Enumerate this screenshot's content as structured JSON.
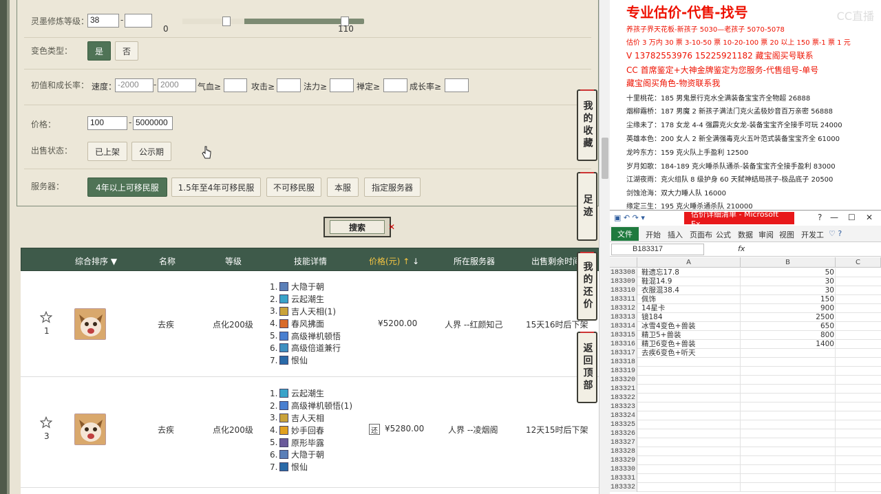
{
  "filter": {
    "level_label": "灵墨修炼等级：",
    "level_min": "38",
    "level_max": "",
    "slider_min": "0",
    "slider_max": "110",
    "color_label": "变色类型：",
    "color_yes": "是",
    "color_no": "否",
    "growth_label": "初值和成长率：",
    "speed_label": "速度：",
    "speed_min": "-2000",
    "speed_max": "2000",
    "hp_label": "气血≥",
    "atk_label": "攻击≥",
    "mag_label": "法力≥",
    "focus_label": "禅定≥",
    "growth_rate_label": "成长率≥",
    "price_label": "价格：",
    "price_min": "100",
    "price_max": "5000000",
    "status_label": "出售状态：",
    "status_listed": "已上架",
    "status_public": "公示期",
    "server_label": "服务器：",
    "servers": [
      "4年以上可移民服",
      "1.5年至4年可移民服",
      "不可移民服",
      "本服",
      "指定服务器"
    ],
    "search": "搜索"
  },
  "table": {
    "headers": {
      "sort": "综合排序",
      "name": "名称",
      "level": "等级",
      "skills": "技能详情",
      "price": "价格(元)",
      "server": "所在服务器",
      "time": "出售剩余时间"
    },
    "rows": [
      {
        "index": "1",
        "name": "去疾",
        "level": "点化200级",
        "skills": [
          "大隐于朝",
          "云起潮生",
          "吉人天相(1)",
          "春风拂面",
          "高级禅机顿悟",
          "高级倍道兼行",
          "恨仙"
        ],
        "price": "¥5200.00",
        "server": "人界 --红颜知己",
        "time": "15天16时后下架",
        "haggle": ""
      },
      {
        "index": "3",
        "name": "去疾",
        "level": "点化200级",
        "skills": [
          "云起潮生",
          "高级禅机顿悟(1)",
          "吉人天相",
          "妙手回春",
          "原形毕露",
          "大隐于朝",
          "恨仙"
        ],
        "price": "¥5280.00",
        "server": "人界 --凌烟阁",
        "time": "12天15时后下架",
        "haggle": "还"
      }
    ]
  },
  "side_tabs": [
    "我的收藏",
    "足迹",
    "我的还价",
    "返回顶部"
  ],
  "ad": {
    "title": "专业估价-代售-找号",
    "line1": "养孩子界天花板-新孩子 5030—老孩子 5070-5078",
    "line2": "估价 3 万内 30 票  3-10-50 票  10-20-100 票  20 以上 150 票-1 票 1 元",
    "line3": "V 13782553976    15225921182  藏宝阁买号联系",
    "line4": "CC 首席鉴定+大神金牌鉴定为您服务-代售组号-单号",
    "line5": "藏宝阁买角色-物资联系我",
    "items": [
      "十里桃花：185 男鬼景行克水全满装备宝宝齐全物超 26888",
      "烟柳霜桥：187 男魔 2 新孩子满法门克火孟极妙音百万亲密 56888",
      "尘缘未了：178 女龙 4-4 强霹克火女龙-装备宝宝齐全接手可玩 24000",
      "英雄本色：200 女人 2 新全满强毒克火五叶范式装备宝宝齐全 61000",
      "龙吟东方：159 克火队上手盈利 12500",
      "岁月如歌：184-189 克火睡杀队通杀-装备宝宝齐全接手盈利 83000",
      "江湖夜雨：克火组队 8 级护身 60 天弑神结局孩子-极品底子 20500",
      "剑蚀沧海：双大力睡人队 16000",
      "缘定三生：195 克火睡杀通杀队 210000"
    ],
    "watermark": "CC直播"
  },
  "excel": {
    "title": "估价详细清单 - Microsoft Ex...",
    "ribbon": [
      "开始",
      "插入",
      "页面布",
      "公式",
      "数据",
      "审阅",
      "视图",
      "开发工"
    ],
    "file": "文件",
    "namebox": "B183317",
    "fx": "fx",
    "cols": [
      "A",
      "B",
      "C"
    ],
    "rows": [
      {
        "n": "183308",
        "a": "鞋遗忘17.8",
        "b": "50"
      },
      {
        "n": "183309",
        "a": "鞋混14.9",
        "b": "30"
      },
      {
        "n": "183310",
        "a": "衣服混38.4",
        "b": "30"
      },
      {
        "n": "183311",
        "a": "佩饰",
        "b": "150"
      },
      {
        "n": "183312",
        "a": "14星卡",
        "b": "900"
      },
      {
        "n": "183313",
        "a": "镜184",
        "b": "2500"
      },
      {
        "n": "183314",
        "a": "冰雪4变色+兽装",
        "b": "650"
      },
      {
        "n": "183315",
        "a": "精卫5+兽装",
        "b": "800"
      },
      {
        "n": "183316",
        "a": "精卫6变色+兽装",
        "b": "1400"
      },
      {
        "n": "183317",
        "a": "去疾6变色+听天",
        "b": ""
      },
      {
        "n": "183318",
        "a": "",
        "b": ""
      },
      {
        "n": "183319",
        "a": "",
        "b": ""
      },
      {
        "n": "183320",
        "a": "",
        "b": ""
      },
      {
        "n": "183321",
        "a": "",
        "b": ""
      },
      {
        "n": "183322",
        "a": "",
        "b": ""
      },
      {
        "n": "183323",
        "a": "",
        "b": ""
      },
      {
        "n": "183324",
        "a": "",
        "b": ""
      },
      {
        "n": "183325",
        "a": "",
        "b": ""
      },
      {
        "n": "183326",
        "a": "",
        "b": ""
      },
      {
        "n": "183327",
        "a": "",
        "b": ""
      },
      {
        "n": "183328",
        "a": "",
        "b": ""
      },
      {
        "n": "183329",
        "a": "",
        "b": ""
      },
      {
        "n": "183330",
        "a": "",
        "b": ""
      },
      {
        "n": "183331",
        "a": "",
        "b": ""
      },
      {
        "n": "183332",
        "a": "",
        "b": ""
      }
    ]
  },
  "colors": {
    "accent_green": "#4f7356",
    "header_green": "#3e5a4a",
    "ad_red": "#e10000",
    "excel_green": "#1f7a3e"
  }
}
